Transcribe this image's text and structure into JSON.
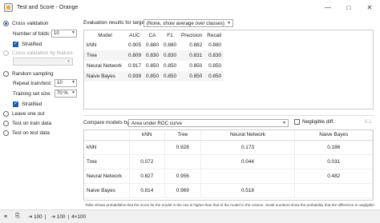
{
  "window": {
    "title": "Test and Score - Orange",
    "controls": [
      "—",
      "□",
      "✕"
    ]
  },
  "sampling": {
    "cross_validation": {
      "label": "Cross validation",
      "selected": true,
      "folds_label": "Number of folds:",
      "folds_value": "10",
      "stratified_label": "Stratified"
    },
    "cv_by_feature": {
      "label": "Cross validation by feature"
    },
    "random_sampling": {
      "label": "Random sampling",
      "repeat_label": "Repeat train/test:",
      "repeat_value": "10",
      "train_size_label": "Training set size:",
      "train_size_value": "70 %",
      "stratified_label": "Stratified"
    },
    "leave_one_out": "Leave one out",
    "test_on_train": "Test on train data",
    "test_on_test": "Test on test data"
  },
  "evaluation": {
    "label": "Evaluation results for target",
    "target_value": "(None, show average over classes)",
    "columns": [
      "Model",
      "AUC",
      "CA",
      "F1",
      "Precision",
      "Recall"
    ],
    "rows": [
      [
        "kNN",
        "0.905",
        "0.880",
        "0.880",
        "0.882",
        "0.880"
      ],
      [
        "Tree",
        "0.809",
        "0.830",
        "0.830",
        "0.831",
        "0.830"
      ],
      [
        "Neural Network",
        "0.917",
        "0.850",
        "0.850",
        "0.850",
        "0.850"
      ],
      [
        "Naive Bayes",
        "0.939",
        "0.850",
        "0.850",
        "0.850",
        "0.850"
      ]
    ]
  },
  "compare": {
    "label": "Compare models by:",
    "by_value": "Area under ROC curve",
    "negligible_label": "Negligible diff.:",
    "negligible_value": "0.1",
    "columns": [
      "kNN",
      "Tree",
      "Neural Network",
      "Naive Bayes"
    ],
    "rows": [
      {
        "name": "kNN",
        "cells": [
          "",
          "0.928",
          "0.173",
          "0.186"
        ]
      },
      {
        "name": "Tree",
        "cells": [
          "0.072",
          "",
          "0.044",
          "0.031"
        ]
      },
      {
        "name": "Neural Network",
        "cells": [
          "0.827",
          "0.956",
          "",
          "0.482"
        ]
      },
      {
        "name": "Naive Bayes",
        "cells": [
          "0.814",
          "0.969",
          "0.518",
          ""
        ]
      }
    ],
    "note": "Table shows probabilities that the score for the model in the row is higher than that of the model in the column. Small numbers show the probability that the difference is negligible."
  },
  "statusbar": {
    "in_count": "100",
    "out_count": "100",
    "out_size": "4×100"
  }
}
